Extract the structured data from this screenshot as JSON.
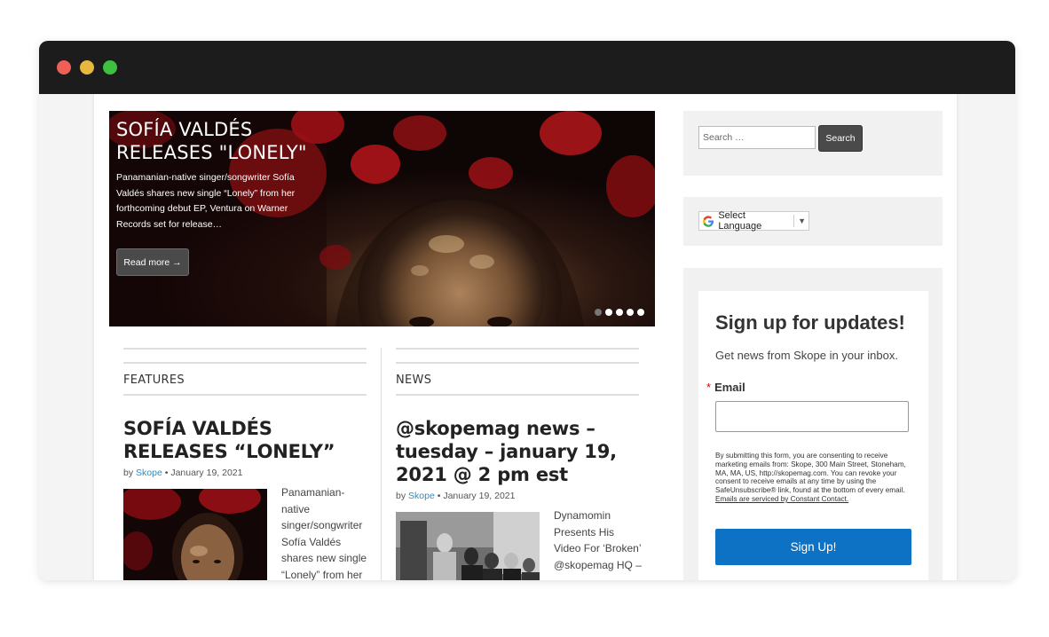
{
  "slider": {
    "title": "SOFÍA VALDÉS RELEASES \"LONELY\"",
    "excerpt": "Panamanian-native singer/songwriter Sofía Valdés shares new single “Lonely” from her forthcoming debut EP, Ventura on Warner Records set for release…",
    "read_more": "Read more →",
    "dots_total": 5,
    "active_index": 0
  },
  "features": {
    "label": "FEATURES",
    "post": {
      "title": "SOFÍA VALDÉS RELEASES “LONELY”",
      "by": "by",
      "author": "Skope",
      "sep": "•",
      "date": "January 19, 2021",
      "excerpt": "Panamanian-native singer/songwriter Sofía Valdés shares new single “Lonely” from her"
    }
  },
  "news": {
    "label": "NEWS",
    "post": {
      "title": "@skopemag news – tuesday – january 19, 2021 @ 2 pm est",
      "by": "by",
      "author": "Skope",
      "sep": "•",
      "date": "January 19, 2021",
      "excerpt": "Dynamomin Presents His Video For ‘Broken’ @skopemag HQ –"
    }
  },
  "sidebar": {
    "search": {
      "placeholder": "Search …",
      "button": "Search"
    },
    "language": {
      "label": "Select Language",
      "caret": "▼"
    },
    "signup": {
      "title": "Sign up for updates!",
      "subtitle": "Get news from Skope in your inbox.",
      "required_marker": "*",
      "email_label": "Email",
      "email_value": "",
      "consent": "By submitting this form, you are consenting to receive marketing emails from: Skope, 300 Main Street, Stoneham, MA, MA, US, http://skopemag.com. You can revoke your consent to receive emails at any time by using the SafeUnsubscribe® link, found at the bottom of every email.",
      "consent_link": "Emails are serviced by Constant Contact.",
      "button": "Sign Up!"
    }
  }
}
